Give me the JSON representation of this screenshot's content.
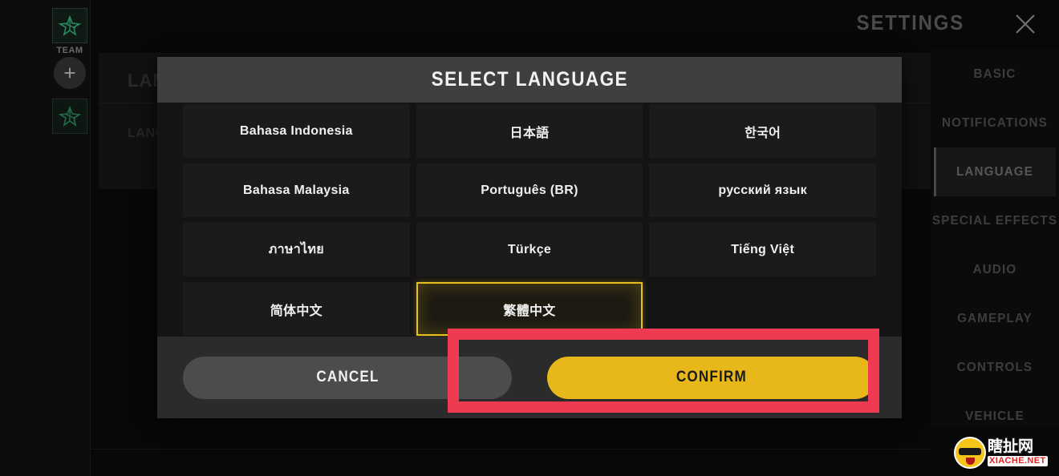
{
  "left_rail": {
    "team_label": "TEAM",
    "add_button": "+",
    "avatar_icon": "player-avatar-icon"
  },
  "background_panel": {
    "title": "LANG",
    "subtitle": "LANG"
  },
  "settings": {
    "title": "SETTINGS",
    "close_label": "close-icon",
    "menu": [
      {
        "label": "BASIC",
        "active": false
      },
      {
        "label": "NOTIFICATIONS",
        "active": false
      },
      {
        "label": "LANGUAGE",
        "active": true
      },
      {
        "label": "SPECIAL EFFECTS",
        "active": false
      },
      {
        "label": "AUDIO",
        "active": false
      },
      {
        "label": "GAMEPLAY",
        "active": false
      },
      {
        "label": "CONTROLS",
        "active": false
      },
      {
        "label": "VEHICLE",
        "active": false
      }
    ]
  },
  "dialog": {
    "title": "SELECT LANGUAGE",
    "languages": [
      {
        "label": "Bahasa Indonesia",
        "selected": false
      },
      {
        "label": "日本語",
        "selected": false
      },
      {
        "label": "한국어",
        "selected": false
      },
      {
        "label": "Bahasa Malaysia",
        "selected": false
      },
      {
        "label": "Português (BR)",
        "selected": false
      },
      {
        "label": "русский язык",
        "selected": false
      },
      {
        "label": "ภาษาไทย",
        "selected": false
      },
      {
        "label": "Türkçe",
        "selected": false
      },
      {
        "label": "Tiếng Việt",
        "selected": false
      },
      {
        "label": "简体中文",
        "selected": false
      },
      {
        "label": "繁體中文",
        "selected": true
      },
      {
        "label": "",
        "selected": false
      }
    ],
    "cancel_label": "CANCEL",
    "confirm_label": "CONFIRM"
  },
  "annotation": {
    "color": "#ef3b52",
    "target": "confirm-button"
  },
  "watermark": {
    "cn_text": "瞎扯网",
    "en_text": "XIACHE.NET"
  },
  "colors": {
    "accent_gold": "#e8b81b",
    "selected_border": "#e5c01e",
    "annotation_red": "#ef3b52",
    "titlebar_gray": "#3f3f3f"
  }
}
